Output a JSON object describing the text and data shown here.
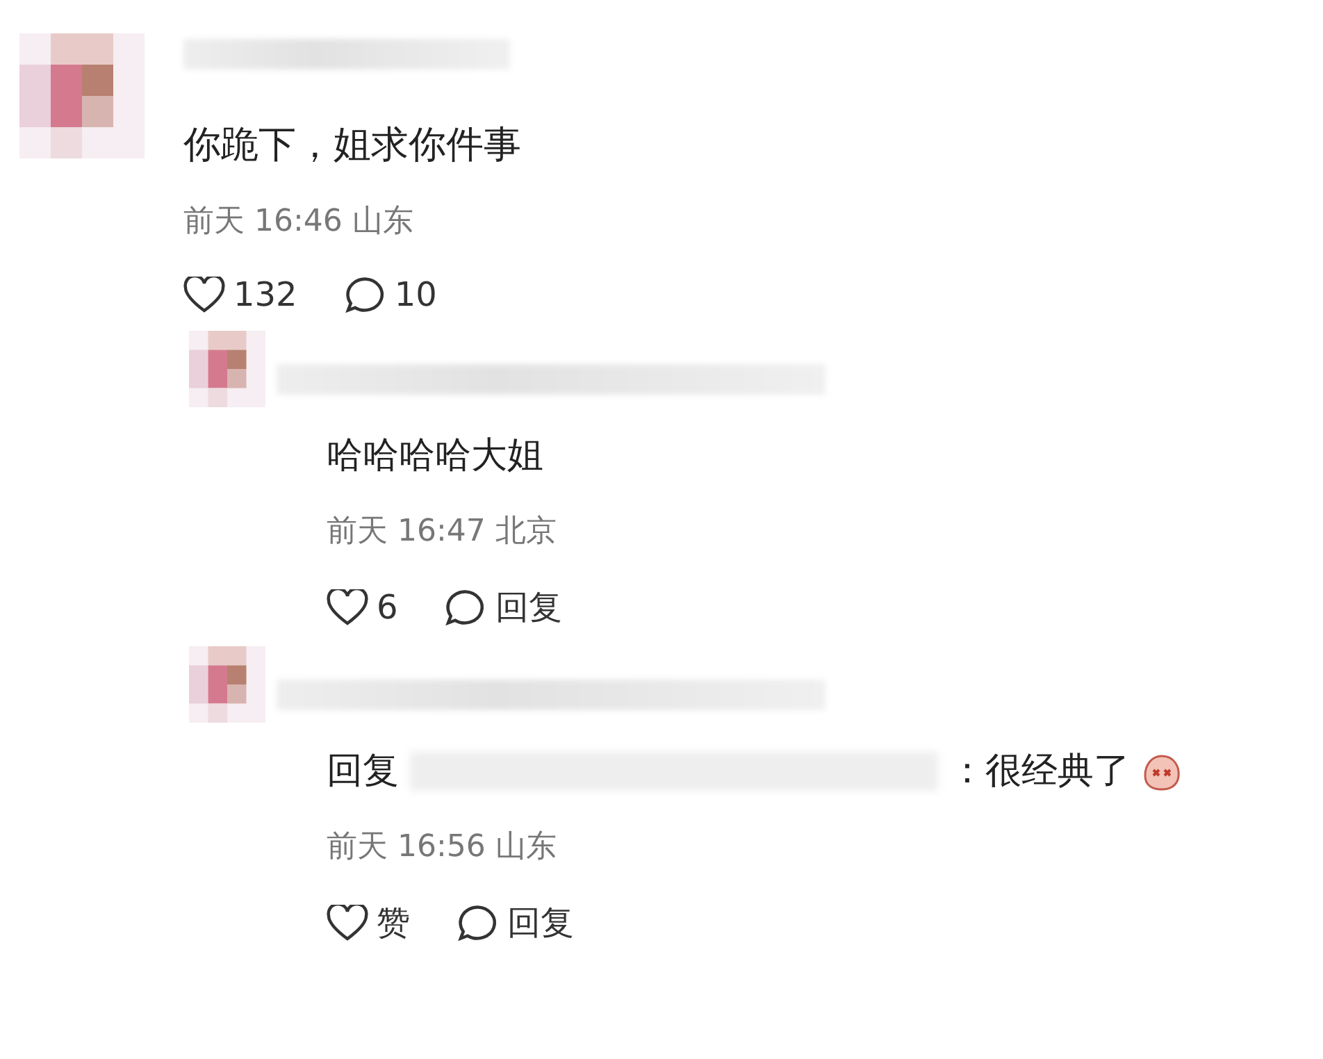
{
  "comments": [
    {
      "text": "你跪下，姐求你件事",
      "time": "前天 16:46",
      "location": "山东",
      "likes": "132",
      "replies": "10",
      "children": [
        {
          "text": "哈哈哈哈大姐",
          "time": "前天 16:47",
          "location": "北京",
          "likes": "6",
          "replies": "回复"
        },
        {
          "reply_prefix": "回复",
          "text": "：很经典了",
          "time": "前天 16:56",
          "location": "山东",
          "likes": "赞",
          "replies": "回复"
        }
      ]
    }
  ]
}
